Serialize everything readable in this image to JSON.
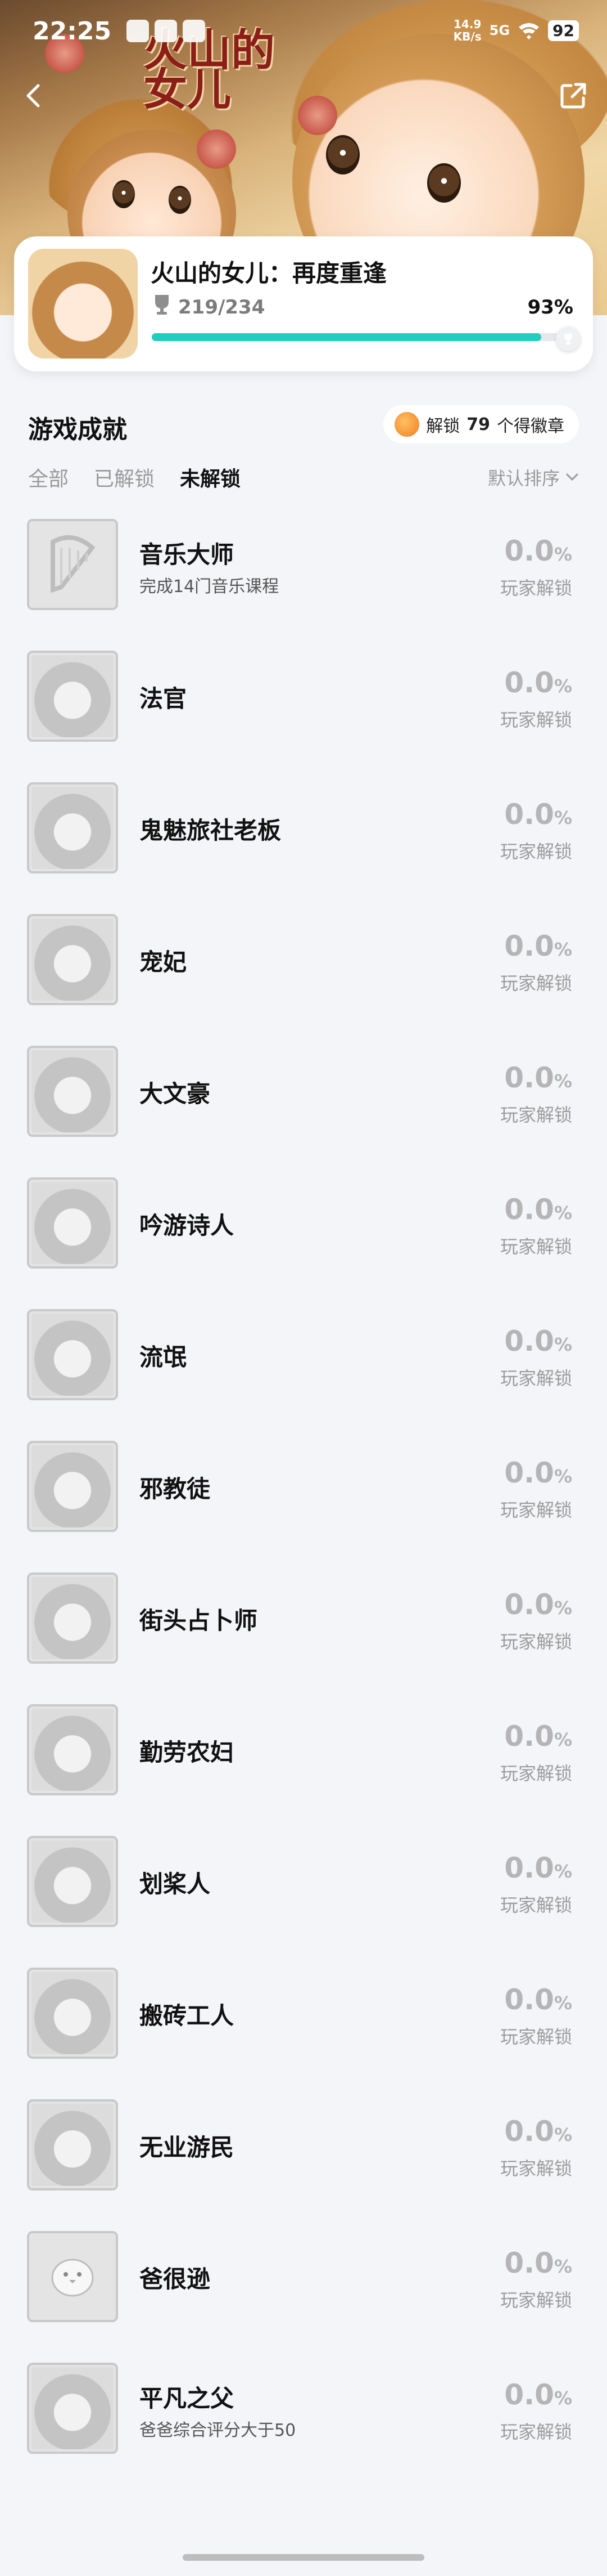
{
  "status_bar": {
    "time": "22:25",
    "network_speed": "14.9",
    "network_unit": "KB/s",
    "signal": "5G",
    "battery": "92"
  },
  "header": {
    "logo_text": "火山的女儿"
  },
  "game": {
    "title": "火山的女儿：再度重逢",
    "progress": "219/234",
    "percent_text": "93%",
    "percent_value": 93
  },
  "section": {
    "title": "游戏成就",
    "badge_prefix": "解锁",
    "badge_count": "79",
    "badge_suffix": "个得徽章"
  },
  "tabs": [
    "全部",
    "已解锁",
    "未解锁"
  ],
  "active_tab": 2,
  "sort_label": "默认排序",
  "achievements": [
    {
      "name": "音乐大师",
      "desc": "完成14门音乐课程",
      "pct": "0.0",
      "unit": "%",
      "sub": "玩家解锁",
      "icon": "harp-icon"
    },
    {
      "name": "法官",
      "desc": "",
      "pct": "0.0",
      "unit": "%",
      "sub": "玩家解锁",
      "icon": "portrait-icon"
    },
    {
      "name": "鬼魅旅社老板",
      "desc": "",
      "pct": "0.0",
      "unit": "%",
      "sub": "玩家解锁",
      "icon": "portrait-icon"
    },
    {
      "name": "宠妃",
      "desc": "",
      "pct": "0.0",
      "unit": "%",
      "sub": "玩家解锁",
      "icon": "portrait-icon"
    },
    {
      "name": "大文豪",
      "desc": "",
      "pct": "0.0",
      "unit": "%",
      "sub": "玩家解锁",
      "icon": "portrait-icon"
    },
    {
      "name": "吟游诗人",
      "desc": "",
      "pct": "0.0",
      "unit": "%",
      "sub": "玩家解锁",
      "icon": "portrait-icon"
    },
    {
      "name": "流氓",
      "desc": "",
      "pct": "0.0",
      "unit": "%",
      "sub": "玩家解锁",
      "icon": "portrait-icon"
    },
    {
      "name": "邪教徒",
      "desc": "",
      "pct": "0.0",
      "unit": "%",
      "sub": "玩家解锁",
      "icon": "portrait-icon"
    },
    {
      "name": "街头占卜师",
      "desc": "",
      "pct": "0.0",
      "unit": "%",
      "sub": "玩家解锁",
      "icon": "portrait-icon"
    },
    {
      "name": "勤劳农妇",
      "desc": "",
      "pct": "0.0",
      "unit": "%",
      "sub": "玩家解锁",
      "icon": "portrait-icon"
    },
    {
      "name": "划桨人",
      "desc": "",
      "pct": "0.0",
      "unit": "%",
      "sub": "玩家解锁",
      "icon": "portrait-icon"
    },
    {
      "name": "搬砖工人",
      "desc": "",
      "pct": "0.0",
      "unit": "%",
      "sub": "玩家解锁",
      "icon": "portrait-icon"
    },
    {
      "name": "无业游民",
      "desc": "",
      "pct": "0.0",
      "unit": "%",
      "sub": "玩家解锁",
      "icon": "portrait-icon"
    },
    {
      "name": "爸很逊",
      "desc": "",
      "pct": "0.0",
      "unit": "%",
      "sub": "玩家解锁",
      "icon": "chick-icon"
    },
    {
      "name": "平凡之父",
      "desc": "爸爸综合评分大于50",
      "pct": "0.0",
      "unit": "%",
      "sub": "玩家解锁",
      "icon": "portrait-icon"
    }
  ],
  "colors": {
    "accent": "#21cdbe",
    "background": "#f4f5f8",
    "muted": "#9c9c9c"
  }
}
